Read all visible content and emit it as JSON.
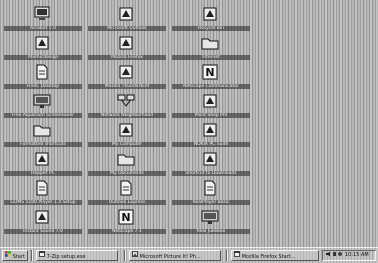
{
  "desktop": {
    "icons": [
      {
        "label": "Acrobat 5.0",
        "icon": "computer-icon"
      },
      {
        "label": "Atomicdesign",
        "icon": "program-icon"
      },
      {
        "label": "FineC Desktop",
        "icon": "document-icon"
      },
      {
        "label": "Free Aquarium Screensaver",
        "icon": "monitor-icon"
      },
      {
        "label": "Formatted shortcuts",
        "icon": "folder-icon"
      },
      {
        "label": "Hopper PC",
        "icon": "program-icon"
      },
      {
        "label": "GOMS 5100 Player 1.4 Setup",
        "icon": "document-icon"
      },
      {
        "label": "Instant Sound 7.0",
        "icon": "program-icon"
      },
      {
        "label": "Microsoft Outlook",
        "icon": "program-icon"
      },
      {
        "label": "Mozilla Firefox",
        "icon": "program-icon"
      },
      {
        "label": "Mozilla Thunderbird",
        "icon": "program-icon"
      },
      {
        "label": "Network Neighborhood",
        "icon": "network-icon"
      },
      {
        "label": "My Computer",
        "icon": "program-icon"
      },
      {
        "label": "My Documents",
        "icon": "folder-icon"
      },
      {
        "label": "Outlook Express",
        "icon": "document-icon"
      },
      {
        "label": "Netscape 7.1",
        "icon": "netscape-icon"
      },
      {
        "label": "Recycle Bin",
        "icon": "program-icon"
      },
      {
        "label": "Internet",
        "icon": "folder-icon"
      },
      {
        "label": "Netscape Communicator",
        "icon": "netscape-icon"
      },
      {
        "label": "Paint Shop Pro",
        "icon": "program-icon"
      },
      {
        "label": "NOKIA PC Suite",
        "icon": "program-icon"
      },
      {
        "label": "Shortcut to Downloads",
        "icon": "program-icon"
      },
      {
        "label": "RealPlayer Basic",
        "icon": "document-icon"
      },
      {
        "label": "Real Jukebox",
        "icon": "monitor-icon"
      }
    ]
  },
  "taskbar": {
    "start_label": "Start",
    "items": [
      {
        "label": "7-Zip setup.exe",
        "icon": "window-icon"
      },
      {
        "label": "Microsoft Picture It! Ph...",
        "icon": "picture-icon"
      },
      {
        "label": "Mozilla Firefox Start...",
        "icon": "window-icon"
      }
    ],
    "tray_time": "10:15 AM"
  },
  "colors": {
    "desktop_bg": "#b7b7b7",
    "taskbar_bg": "#c6c6c6",
    "label_bg": "#232323"
  }
}
